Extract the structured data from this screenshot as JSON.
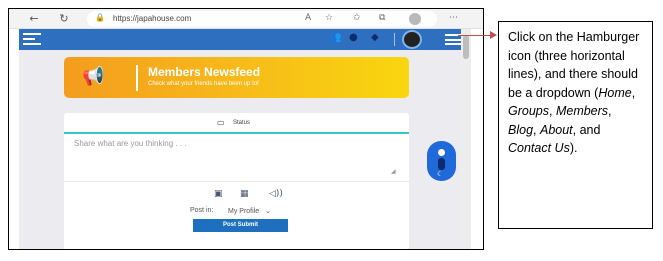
{
  "browser": {
    "url": "https://japahouse.com",
    "back_icon": "arrow-left-icon",
    "reload_icon": "reload-icon",
    "menu_icon": "ellipsis-icon"
  },
  "site_header": {
    "background": "#2e6fc0",
    "icons": [
      "sidebar-menu-icon",
      "friends-icon",
      "chat-icon",
      "notifications-icon",
      "avatar",
      "hamburger-icon"
    ]
  },
  "banner": {
    "title": "Members Newsfeed",
    "subtitle": "Check what your friends have been up to!",
    "gradient": [
      "#f49c1e",
      "#f9d60e"
    ]
  },
  "status": {
    "tab_label": "Status",
    "placeholder": "Share what are you thinking . . .",
    "post_in_label": "Post in:",
    "post_in_value": "My Profile",
    "submit_label": "Post Submit",
    "accent": "#34c6c9",
    "button_color": "#1e6fbe"
  },
  "annotation": {
    "text_parts": [
      "Click on the Hamburger icon (three horizontal lines), and there should be a dropdown (",
      "Home",
      ", ",
      "Groups",
      ", ",
      "Members",
      ", ",
      "Blog",
      ", ",
      "About",
      ", and ",
      "Contact Us",
      ")."
    ],
    "arrow_color": "#c0504d"
  }
}
